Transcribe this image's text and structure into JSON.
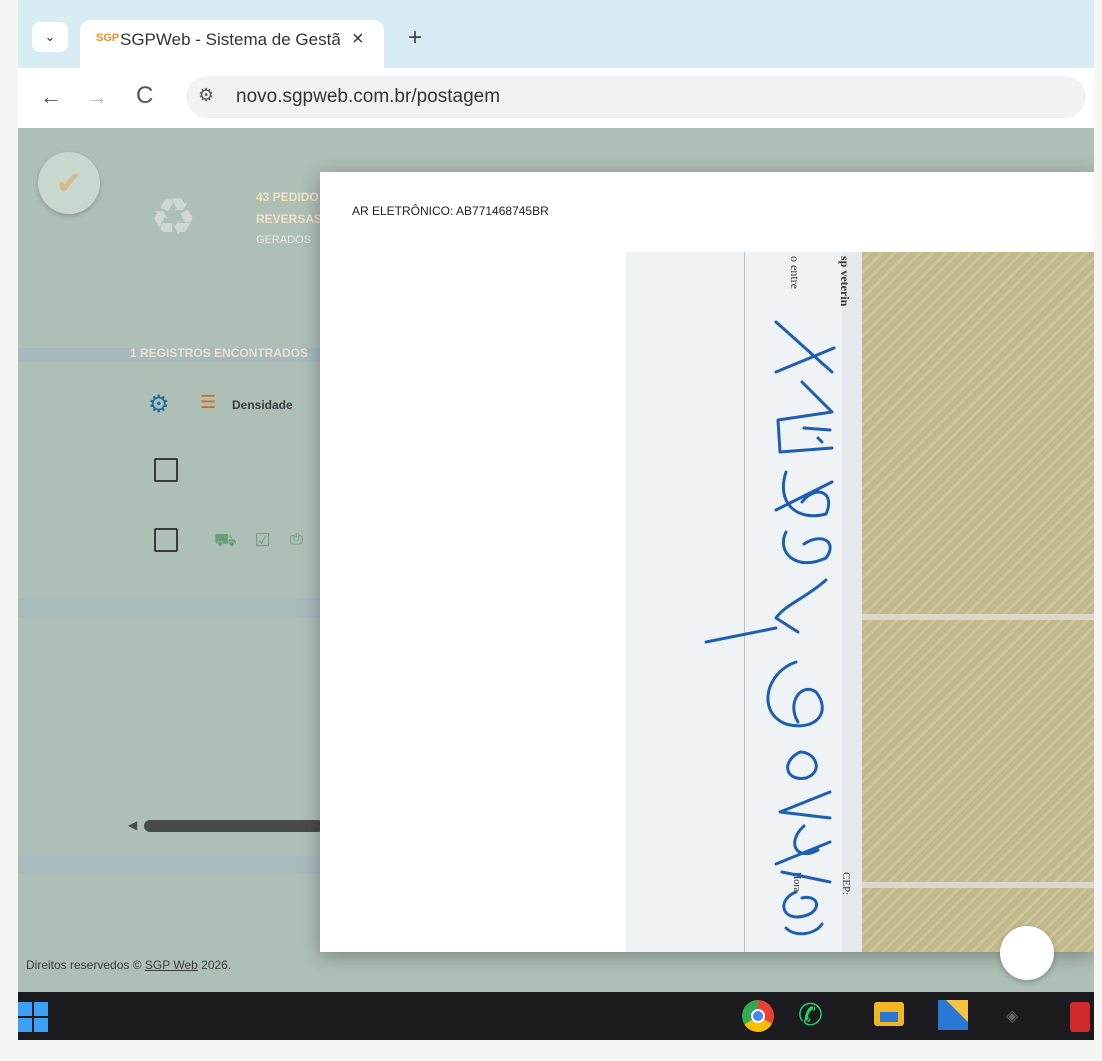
{
  "browser": {
    "tab_title": "SGPWeb - Sistema de Gestão d",
    "tab_favicon": "SGP",
    "tab_close": "×",
    "new_tab": "+",
    "tab_menu": "⌄",
    "url": "novo.sgpweb.com.br/postagem",
    "back": "←",
    "forward": "→",
    "reload": "C",
    "site_info": "⚙"
  },
  "page": {
    "stat_line1": "43 PEDIDO",
    "stat_line2": "REVERSAS",
    "stat_line3": "GERADOS",
    "records": "1 REGISTROS ENCONTRADOS",
    "density_label": "Densidade",
    "footer_text": "Direitos reservedos © ",
    "footer_link": "SGP Web",
    "footer_year": " 2026."
  },
  "modal": {
    "title": "AR ELETRÔNICO: AB771468745BR",
    "scan_text_top_left": "o entre",
    "scan_text_top_right": "sp veterin",
    "scan_text_bottom_left": "Hora",
    "scan_text_bottom_right": "CEP: ",
    "signature": "Éder Gonçalves"
  },
  "icons": {
    "check": "check-icon",
    "recycle": "recycle-icon",
    "gear": "gear-icon",
    "menu": "menu-icon",
    "windows": "windows-start-icon",
    "chrome": "chrome-icon",
    "whatsapp": "whatsapp-icon",
    "folder": "file-explorer-icon"
  }
}
